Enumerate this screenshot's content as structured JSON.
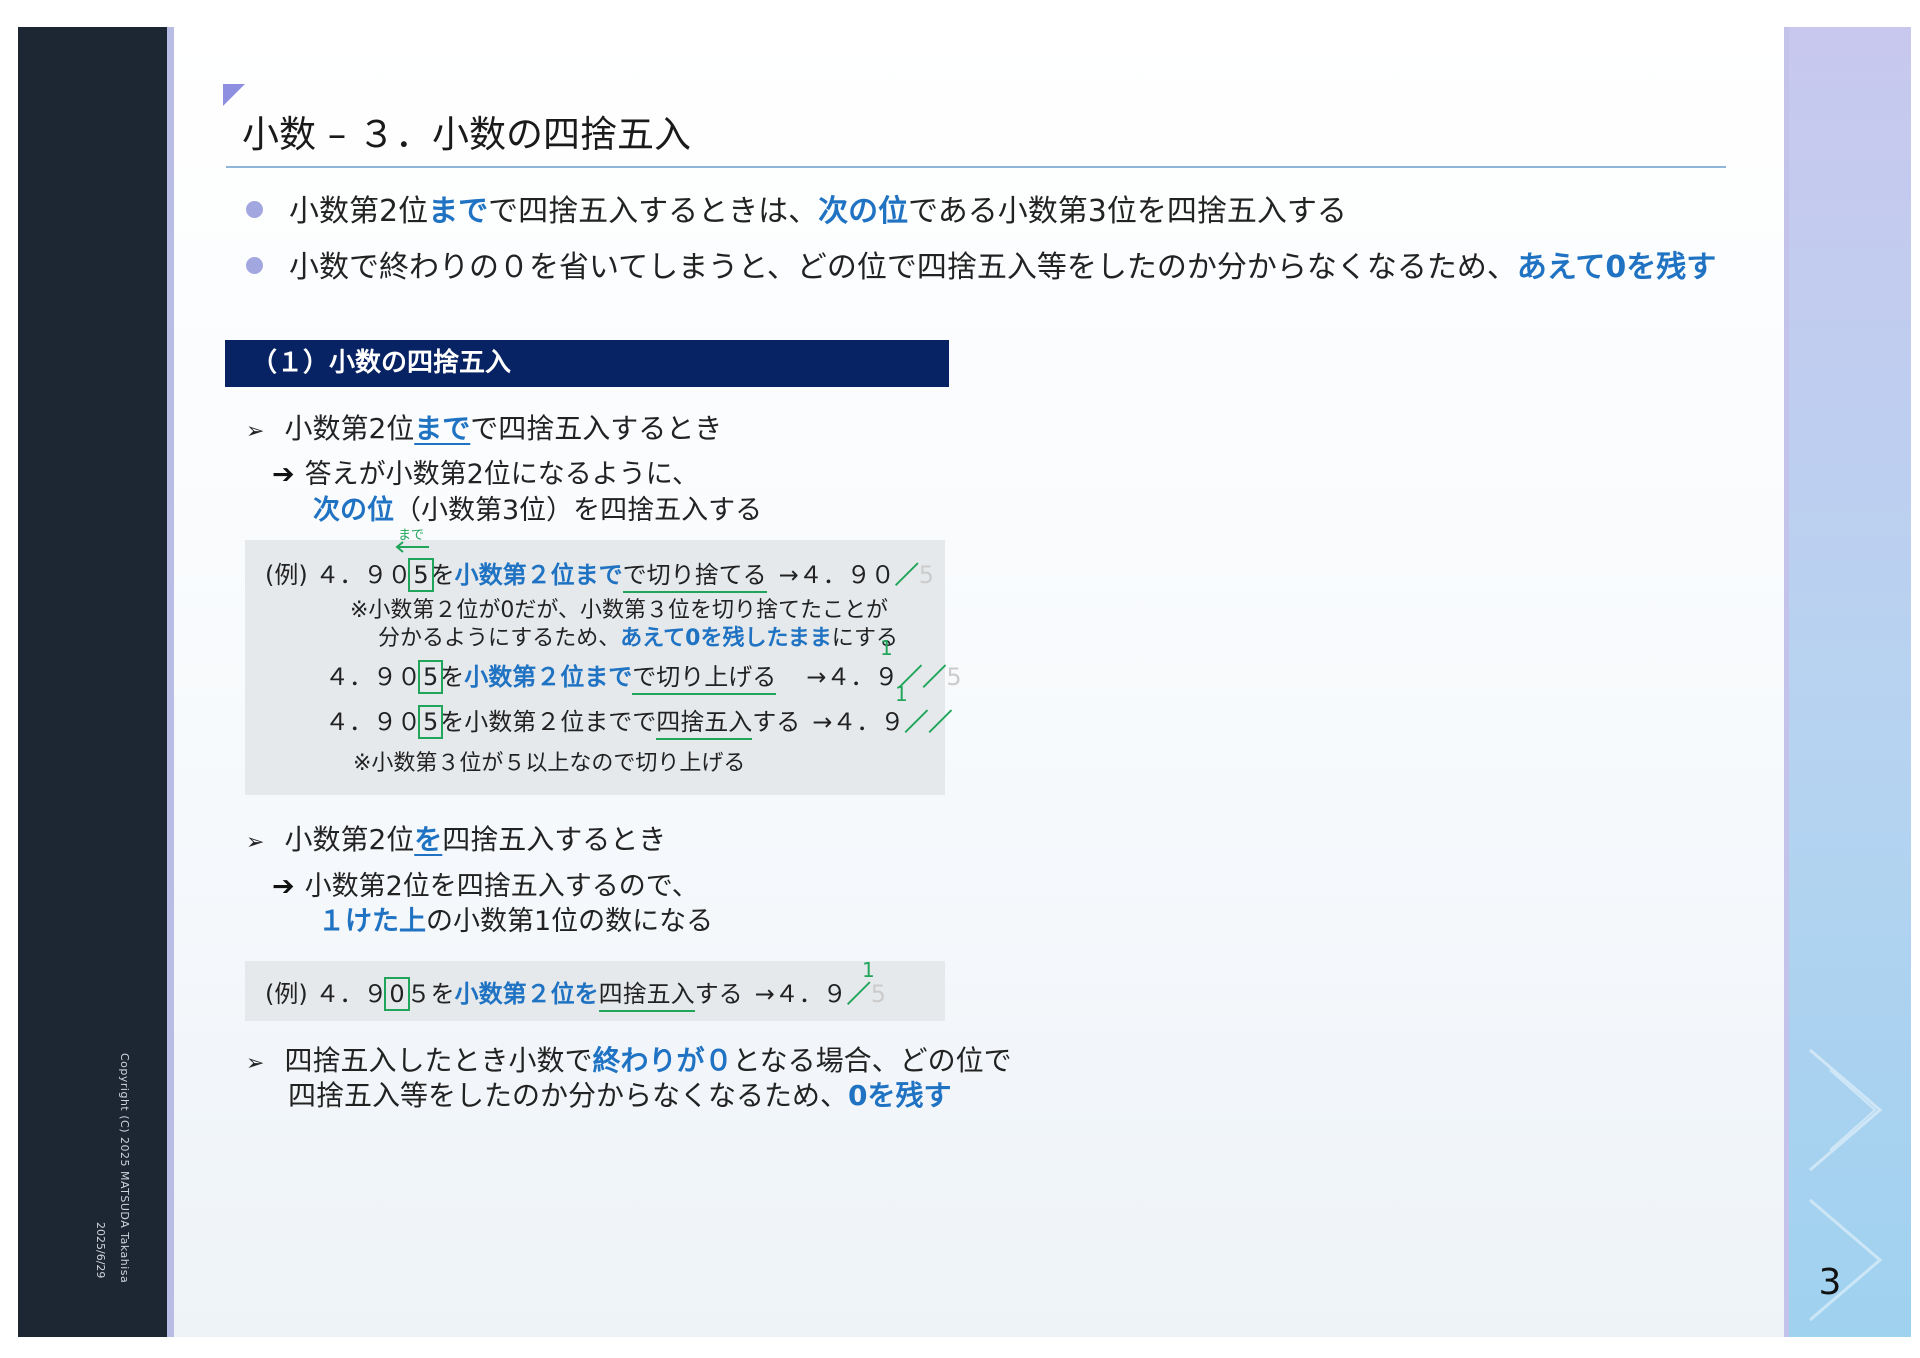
{
  "slide": {
    "title": "小数 – ３．小数の四捨五入",
    "page_number": "3",
    "copyright": "Copyright (C) 2025 MATSUDA Takahisa",
    "date": "2025/6/29"
  },
  "bullets": [
    {
      "p1": "小数第2位",
      "h1": "まで",
      "p2": "で四捨五入するときは、",
      "h2": "次の位",
      "p3": "である小数第3位を四捨五入する"
    },
    {
      "p1": "小数で終わりの０を省いてしまうと、どの位で四捨五入等をしたのか分からなくなるため、",
      "h1": "あえて0を残す"
    }
  ],
  "section": {
    "heading": "（１）小数の四捨五入"
  },
  "item1": {
    "a": "小数第2位",
    "b": "まで",
    "c": "で四捨五入するとき",
    "sub1": "答えが小数第2位になるように、",
    "sub2_hl": "次の位",
    "sub2_rest": "（小数第3位）を四捨五入する"
  },
  "example1": {
    "made_label": "まで",
    "line1": {
      "prefix": "(例) ４．９０",
      "digit": "5",
      "wo": "を",
      "hl": "小数第２位まで",
      "verb": "で切り捨てる",
      "result": "→４．９０",
      "faint": "5",
      "mark": "／"
    },
    "note1": "※小数第２位が0だが、小数第３位を切り捨てたことが",
    "note2_a": "分かるようにするため、",
    "note2_hl": "あえて0を残したまま",
    "note2_b": "にする",
    "line2": {
      "prefix": "４．９０",
      "digit": "5",
      "wo": "を",
      "hl": "小数第２位まで",
      "verb": "で切り上げる",
      "result": "→４．９",
      "carry": "1",
      "mark": "／／",
      "faint": "5"
    },
    "line3": {
      "prefix": "４．９０",
      "digit": "5",
      "mid": "を小数第２位までで",
      "verb": "四捨五入",
      "post": "する",
      "result": "→４．９",
      "carry": "1",
      "mark": "／／"
    },
    "note3": "※小数第３位が５以上なので切り上げる"
  },
  "item2": {
    "a": "小数第2位",
    "b": "を",
    "c": "四捨五入するとき",
    "sub1": "小数第2位を四捨五入するので、",
    "sub2_hl": "１けた上",
    "sub2_rest": "の小数第1位の数になる"
  },
  "example2": {
    "prefix": "(例) ４．９",
    "digit": "0",
    "after": "５を",
    "hl": "小数第２位を",
    "verb": "四捨五入",
    "post": "する",
    "result": "→４．９",
    "carry": "1",
    "mark": "／",
    "faint": "5"
  },
  "item3": {
    "l1_a": "四捨五入したとき小数で",
    "l1_hl": "終わりが０",
    "l1_b": "となる場合、どの位で",
    "l2_a": "四捨五入等をしたのか分からなくなるため、",
    "l2_hl": "0を残す"
  }
}
